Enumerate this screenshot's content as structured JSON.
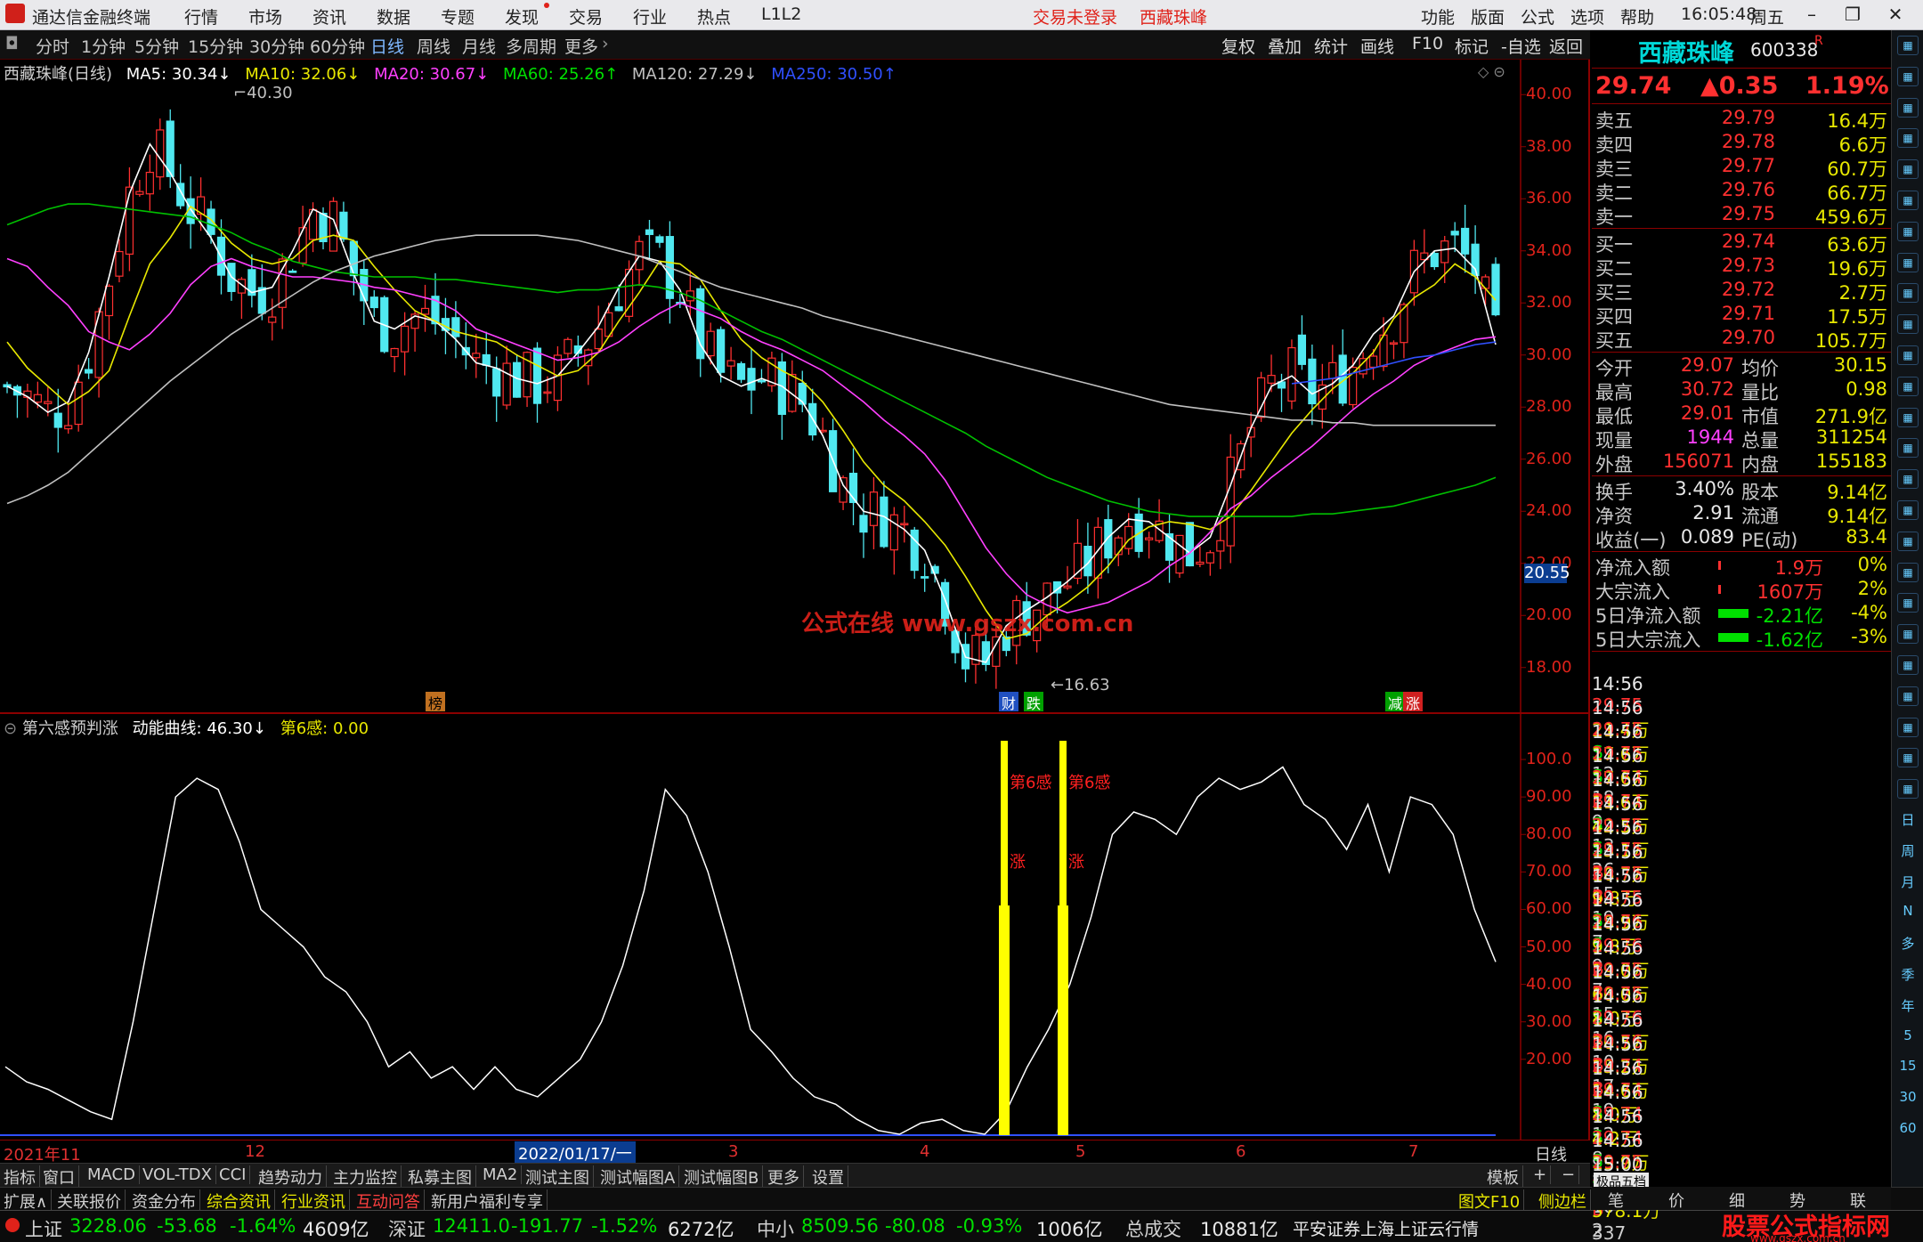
{
  "window": {
    "app_title": "通达信金融终端",
    "menu": [
      "行情",
      "市场",
      "资讯",
      "数据",
      "专题",
      "发现",
      "交易",
      "行业",
      "热点",
      "L1L2"
    ],
    "trade_status": "交易未登录",
    "stock_title": "西藏珠峰",
    "right_menu": [
      "功能",
      "版面",
      "公式",
      "选项",
      "帮助"
    ],
    "clock": "16:05:48",
    "weekday": "周五"
  },
  "periods": {
    "items": [
      "分时",
      "1分钟",
      "5分钟",
      "15分钟",
      "30分钟",
      "60分钟",
      "日线",
      "周线",
      "月线",
      "多周期",
      "更多"
    ],
    "active": "日线",
    "right_buttons": [
      "复权",
      "叠加",
      "统计",
      "画线",
      "F10",
      "标记",
      "-自选",
      "返回"
    ]
  },
  "main_legend": {
    "name": "西藏珠峰(日线)",
    "ma5": "MA5: 30.34↓",
    "ma10": "MA10: 32.06↓",
    "ma20": "MA20: 30.67↓",
    "ma60": "MA60: 25.26↑",
    "ma120": "MA120: 27.29↓",
    "ma250": "MA250: 30.50↑"
  },
  "main_axis": {
    "ticks": [
      "40.00",
      "38.00",
      "36.00",
      "34.00",
      "32.00",
      "30.00",
      "28.00",
      "26.00",
      "24.00",
      "22.00",
      "20.00",
      "18.00"
    ],
    "cursor_price": "20.55",
    "high_label": "40.30",
    "low_label": "16.63"
  },
  "watermark": "公式在线 www.gszx.com.cn",
  "event_markers": [
    "榜",
    "财",
    "跌",
    "减",
    "涨"
  ],
  "sub_legend": {
    "name": "第六感预判涨",
    "curve": "动能曲线: 46.30↓",
    "sense": "第6感: 0.00"
  },
  "sub_axis": {
    "ticks": [
      "100.0",
      "90.00",
      "80.00",
      "70.00",
      "60.00",
      "50.00",
      "40.00",
      "30.00",
      "20.00"
    ]
  },
  "sub_signals": {
    "label1": "第6感",
    "label2": "第6感",
    "mark1": "涨",
    "mark2": "涨"
  },
  "xaxis": {
    "labels": [
      "2021年11",
      "12",
      "2022/01/17/一",
      "3",
      "4",
      "5",
      "6",
      "7"
    ],
    "period": "日线"
  },
  "tabs1": [
    "指标",
    "窗口",
    "MACD",
    "VOL-TDX",
    "CCI",
    "趋势动力",
    "主力监控",
    "私募主图",
    "MA2",
    "测试主图",
    "测试幅图A",
    "测试幅图B",
    "更多",
    "设置"
  ],
  "tabs1_right": [
    "模板",
    "+",
    "−"
  ],
  "tabs2": [
    "扩展∧",
    "关联报价",
    "资金分布",
    "综合资讯",
    "行业资讯",
    "互动问答",
    "新用户福利专享"
  ],
  "tabs2_right": [
    "图文F10",
    "侧边栏"
  ],
  "status": {
    "sh_label": "上证",
    "sh_value": "3228.06",
    "sh_change": "-53.68",
    "sh_pct": "-1.64%",
    "sh_amount": "4609亿",
    "sz_label": "深证",
    "sz_value": "12411.0",
    "sz_change": "-191.77",
    "sz_pct": "-1.52%",
    "sz_amount": "6272亿",
    "zx_label": "中小",
    "zx_value": "8509.56",
    "zx_change": "-80.08",
    "zx_pct": "-0.93%",
    "zx_amount": "1006亿",
    "total_label": "总成交",
    "total_value": "10881亿",
    "broker": "平安证券上海上证云行情",
    "brand": "股票公式指标网",
    "brand_url": "www.gszx.com.cn"
  },
  "quote": {
    "name": "西藏珠峰",
    "code": "600338",
    "mark": "R",
    "price": "29.74",
    "change": "▲0.35",
    "pct": "1.19%",
    "asks": [
      {
        "l": "卖五",
        "p": "29.79",
        "v": "16.4万"
      },
      {
        "l": "卖四",
        "p": "29.78",
        "v": "6.6万"
      },
      {
        "l": "卖三",
        "p": "29.77",
        "v": "60.7万"
      },
      {
        "l": "卖二",
        "p": "29.76",
        "v": "66.7万"
      },
      {
        "l": "卖一",
        "p": "29.75",
        "v": "459.6万"
      }
    ],
    "bids": [
      {
        "l": "买一",
        "p": "29.74",
        "v": "63.6万"
      },
      {
        "l": "买二",
        "p": "29.73",
        "v": "19.6万"
      },
      {
        "l": "买三",
        "p": "29.72",
        "v": "2.7万"
      },
      {
        "l": "买四",
        "p": "29.71",
        "v": "17.5万"
      },
      {
        "l": "买五",
        "p": "29.70",
        "v": "105.7万"
      }
    ],
    "stats": [
      [
        "今开",
        "29.07",
        "均价",
        "30.15"
      ],
      [
        "最高",
        "30.72",
        "量比",
        "0.98"
      ],
      [
        "最低",
        "29.01",
        "市值",
        "271.9亿"
      ],
      [
        "现量",
        "1944",
        "总量",
        "311254"
      ],
      [
        "外盘",
        "156071",
        "内盘",
        "155183"
      ]
    ],
    "stats2": [
      [
        "换手",
        "3.40%",
        "股本",
        "9.14亿"
      ],
      [
        "净资",
        "2.91",
        "流通",
        "9.14亿"
      ],
      [
        "收益(一)",
        "0.089",
        "PE(动)",
        "83.4"
      ]
    ],
    "flows": [
      [
        "净流入额",
        "1.9万",
        "0%"
      ],
      [
        "大宗流入",
        "1607万",
        "2%"
      ],
      [
        "5日净流入额",
        "-2.21亿",
        "-4%"
      ],
      [
        "5日大宗流入",
        "-1.62亿",
        "-3%"
      ]
    ],
    "ticks": [
      [
        "14:56",
        "29.75",
        "21.4万",
        "S",
        "12"
      ],
      [
        "14:56",
        "29.75",
        "17.6万",
        "S",
        "18"
      ],
      [
        "14:56",
        "29.75",
        "17.6万",
        "B",
        "9"
      ],
      [
        "14:56",
        "29.74",
        "11.6万",
        "S",
        "13"
      ],
      [
        "14:56",
        "29.74",
        "42.5万",
        "S",
        "26"
      ],
      [
        "14:56",
        "29.75",
        "13.1万",
        "B",
        "15"
      ],
      [
        "14:56",
        "29.75",
        "16.7万",
        "B",
        "19"
      ],
      [
        "14:56",
        "29.75",
        "9.8万",
        "S",
        "7"
      ],
      [
        "14:56",
        "29.75",
        "28.9万",
        "S",
        "9"
      ],
      [
        "14:56",
        "29.76",
        "9.8万",
        "B",
        "7"
      ],
      [
        "14:56",
        "29.76",
        "19.0万",
        "B",
        "15"
      ],
      [
        "14:56",
        "29.75",
        "66.0万",
        "S",
        "16"
      ],
      [
        "14:56",
        "29.75",
        "8.0万",
        "B",
        "10"
      ],
      [
        "14:56",
        "29.76",
        "20.5万",
        "B",
        "17"
      ],
      [
        "14:56",
        "29.76",
        "15.2万",
        "B",
        "19"
      ],
      [
        "14:56",
        "29.74",
        "14.6万",
        "S",
        "12"
      ],
      [
        "14:56",
        "29.74",
        "8.0万",
        "S",
        "8"
      ],
      [
        "14:56",
        "29.74",
        "4.2万",
        "S",
        "7"
      ],
      [
        "14:56",
        "29.74",
        "19.9万",
        "S",
        "10"
      ],
      [
        "14:56",
        "29.75",
        "4.8万",
        "B",
        "2"
      ],
      [
        "15:00",
        "29.74",
        "578.1万",
        "",
        "337"
      ]
    ],
    "bottom_tabs": [
      "笔",
      "价",
      "细",
      "势",
      "联"
    ],
    "tick_footer": "极品五档"
  },
  "toolbar_icons": [
    "1",
    "2",
    "3",
    "4",
    "5",
    "6",
    "7",
    "8",
    "9",
    "10",
    "11",
    "12",
    "13",
    "14",
    "15",
    "16",
    "17",
    "18",
    "19",
    "20",
    "21",
    "22",
    "23",
    "24",
    "25",
    "日",
    "周",
    "月",
    "N",
    "多",
    "季",
    "年",
    "5",
    "15",
    "30",
    "60"
  ],
  "chart_data": [
    {
      "type": "line",
      "title": "西藏珠峰(日线)",
      "ylim": [
        16,
        41
      ],
      "series": [
        {
          "name": "MA5",
          "color": "#ffffff",
          "values": [
            28.8,
            28.4,
            27.8,
            28.2,
            30.1,
            33.0,
            36.2,
            38.1,
            37.0,
            35.6,
            34.5,
            33.0,
            32.4,
            32.6,
            34.0,
            35.6,
            35.2,
            33.1,
            31.3,
            31.0,
            31.5,
            31.3,
            30.6,
            29.7,
            29.5,
            29.1,
            28.9,
            29.2,
            30.1,
            31.1,
            32.6,
            33.8,
            33.6,
            32.5,
            30.4,
            29.2,
            28.8,
            29.1,
            28.8,
            28.2,
            26.9,
            25.0,
            24.0,
            23.8,
            23.3,
            22.5,
            20.6,
            18.4,
            18.2,
            19.6,
            20.2,
            20.7,
            21.3,
            22.0,
            23.0,
            23.7,
            23.6,
            23.0,
            22.4,
            23.0,
            25.0,
            27.2,
            28.8,
            29.2,
            28.5,
            28.9,
            29.6,
            30.8,
            31.5,
            33.2,
            34.0,
            34.1,
            33.3,
            30.4
          ]
        },
        {
          "name": "MA10",
          "color": "#e8e800",
          "values": [
            30.5,
            29.5,
            28.8,
            28.1,
            28.6,
            29.4,
            31.5,
            33.5,
            34.5,
            35.7,
            35.2,
            34.3,
            33.7,
            33.5,
            33.7,
            34.4,
            34.6,
            34.4,
            33.4,
            32.5,
            31.7,
            31.3,
            30.9,
            30.7,
            30.5,
            30.0,
            29.6,
            29.2,
            29.4,
            30.1,
            31.3,
            32.4,
            33.6,
            33.5,
            32.9,
            31.7,
            30.6,
            29.9,
            29.4,
            29.0,
            28.2,
            27.1,
            25.9,
            25.0,
            24.4,
            23.6,
            22.7,
            21.5,
            20.2,
            19.1,
            19.3,
            20.0,
            20.5,
            21.1,
            21.9,
            22.9,
            23.4,
            23.6,
            23.5,
            23.3,
            23.8,
            24.8,
            25.9,
            27.0,
            27.9,
            28.7,
            29.3,
            30.1,
            31.4,
            32.2,
            32.7,
            33.5,
            33.0,
            32.1
          ]
        },
        {
          "name": "MA20",
          "color": "#ff40ff",
          "values": [
            33.7,
            33.4,
            32.6,
            31.9,
            30.9,
            30.5,
            30.2,
            30.8,
            31.6,
            32.7,
            33.4,
            33.7,
            33.4,
            33.2,
            33.0,
            33.0,
            32.9,
            32.8,
            32.6,
            32.5,
            32.3,
            32.1,
            31.7,
            31.0,
            30.7,
            30.4,
            30.1,
            29.8,
            29.9,
            30.1,
            30.5,
            31.1,
            31.6,
            32.0,
            31.7,
            31.4,
            30.9,
            30.5,
            30.2,
            29.8,
            29.4,
            28.8,
            28.2,
            27.5,
            26.9,
            26.2,
            25.2,
            23.9,
            22.6,
            21.6,
            20.8,
            20.4,
            20.1,
            20.3,
            20.5,
            20.9,
            21.3,
            21.9,
            22.4,
            23.2,
            24.1,
            24.6,
            25.3,
            25.9,
            26.5,
            27.2,
            27.9,
            28.5,
            29.0,
            29.6,
            30.0,
            30.3,
            30.6,
            30.7
          ]
        },
        {
          "name": "MA60",
          "color": "#00c000",
          "values": [
            35.0,
            35.3,
            35.6,
            35.8,
            35.8,
            35.7,
            35.6,
            35.5,
            35.4,
            35.3,
            35.0,
            34.7,
            34.3,
            34.0,
            33.6,
            33.4,
            33.2,
            33.1,
            33.0,
            33.0,
            33.0,
            32.9,
            32.9,
            32.8,
            32.7,
            32.6,
            32.5,
            32.4,
            32.5,
            32.5,
            32.6,
            32.7,
            32.6,
            32.4,
            32.1,
            31.7,
            31.3,
            30.9,
            30.6,
            30.2,
            29.8,
            29.4,
            29.0,
            28.6,
            28.2,
            27.8,
            27.4,
            27.0,
            26.5,
            26.1,
            25.7,
            25.3,
            25.0,
            24.7,
            24.4,
            24.2,
            24.0,
            23.9,
            23.8,
            23.8,
            23.8,
            23.8,
            23.8,
            23.8,
            23.9,
            23.9,
            24.0,
            24.1,
            24.2,
            24.4,
            24.6,
            24.8,
            25.0,
            25.3
          ]
        },
        {
          "name": "MA120",
          "color": "#c0c0c0",
          "values": [
            24.3,
            24.6,
            25.0,
            25.5,
            26.2,
            26.9,
            27.6,
            28.3,
            29.0,
            29.6,
            30.2,
            30.8,
            31.3,
            31.8,
            32.3,
            32.8,
            33.2,
            33.5,
            33.8,
            34.0,
            34.2,
            34.4,
            34.5,
            34.6,
            34.6,
            34.6,
            34.6,
            34.5,
            34.4,
            34.2,
            34.0,
            33.8,
            33.5,
            33.2,
            32.9,
            32.6,
            32.4,
            32.2,
            32.0,
            31.8,
            31.5,
            31.3,
            31.1,
            30.9,
            30.7,
            30.5,
            30.3,
            30.1,
            29.9,
            29.7,
            29.5,
            29.3,
            29.1,
            28.9,
            28.7,
            28.5,
            28.3,
            28.1,
            28.0,
            27.9,
            27.8,
            27.7,
            27.6,
            27.5,
            27.5,
            27.4,
            27.4,
            27.3,
            27.3,
            27.3,
            27.3,
            27.3,
            27.3,
            27.3
          ]
        },
        {
          "name": "MA250",
          "color": "#3050ff",
          "values": [
            null,
            null,
            null,
            null,
            null,
            null,
            null,
            null,
            null,
            null,
            null,
            null,
            null,
            null,
            null,
            null,
            null,
            null,
            null,
            null,
            null,
            null,
            null,
            null,
            null,
            null,
            null,
            null,
            null,
            null,
            null,
            null,
            null,
            null,
            null,
            null,
            null,
            null,
            null,
            null,
            null,
            null,
            null,
            null,
            null,
            null,
            null,
            null,
            null,
            null,
            null,
            null,
            null,
            null,
            null,
            null,
            null,
            null,
            null,
            null,
            null,
            null,
            null,
            28.9,
            29.0,
            29.1,
            29.3,
            29.5,
            29.7,
            29.9,
            30.0,
            30.2,
            30.4,
            30.5
          ]
        }
      ]
    },
    {
      "type": "line",
      "title": "第六感预判涨",
      "ylim": [
        0,
        105
      ],
      "series": [
        {
          "name": "动能曲线",
          "color": "#ffffff",
          "values": [
            18,
            14,
            12,
            9,
            6,
            4,
            30,
            60,
            90,
            95,
            92,
            78,
            60,
            55,
            50,
            42,
            38,
            30,
            18,
            22,
            15,
            18,
            12,
            18,
            12,
            10,
            15,
            20,
            30,
            45,
            65,
            92,
            85,
            70,
            50,
            28,
            22,
            15,
            10,
            8,
            4,
            1,
            0,
            3,
            4,
            1,
            0,
            6,
            18,
            28,
            40,
            58,
            80,
            86,
            84,
            80,
            90,
            95,
            92,
            94,
            98,
            88,
            84,
            76,
            88,
            70,
            90,
            88,
            80,
            60,
            46
          ]
        }
      ]
    }
  ]
}
